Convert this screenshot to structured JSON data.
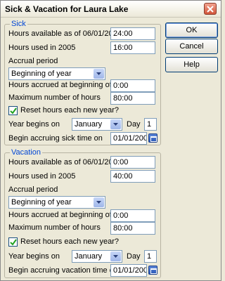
{
  "window": {
    "title": "Sick & Vacation for Laura Lake"
  },
  "buttons": {
    "ok": "OK",
    "cancel": "Cancel",
    "help": "Help"
  },
  "sick": {
    "title": "Sick",
    "available_label": "Hours available as of 06/01/2005",
    "available_value": "24:00",
    "used_label": "Hours used in 2005",
    "used_value": "16:00",
    "accrual_label": "Accrual period",
    "accrual_value": "Beginning of year",
    "accrued_label": "Hours accrued at beginning of year",
    "accrued_value": "0:00",
    "max_label": "Maximum number of hours",
    "max_value": "80:00",
    "reset_label": "Reset hours each new year?",
    "reset_checked": true,
    "year_begins_label": "Year begins on",
    "year_begins_month": "January",
    "day_label": "Day",
    "day_value": "1",
    "begin_label": "Begin accruing sick time on",
    "begin_value": "01/01/2005"
  },
  "vacation": {
    "title": "Vacation",
    "available_label": "Hours available as of 06/01/2005",
    "available_value": "0:00",
    "used_label": "Hours used in 2005",
    "used_value": "40:00",
    "accrual_label": "Accrual period",
    "accrual_value": "Beginning of year",
    "accrued_label": "Hours accrued at beginning of year",
    "accrued_value": "0:00",
    "max_label": "Maximum number of hours",
    "max_value": "80:00",
    "reset_label": "Reset hours each new year?",
    "reset_checked": true,
    "year_begins_label": "Year begins on",
    "year_begins_month": "January",
    "day_label": "Day",
    "day_value": "1",
    "begin_label": "Begin accruing vacation time on",
    "begin_value": "01/01/2005"
  },
  "icons": {
    "close": "close-icon",
    "dropdown": "chevron-down-icon",
    "calendar": "calendar-icon",
    "check": "check-icon"
  },
  "colors": {
    "group_title": "#0046d5",
    "dialog_bg": "#ece9d8",
    "field_border": "#7f9db9",
    "check": "#21a121"
  }
}
